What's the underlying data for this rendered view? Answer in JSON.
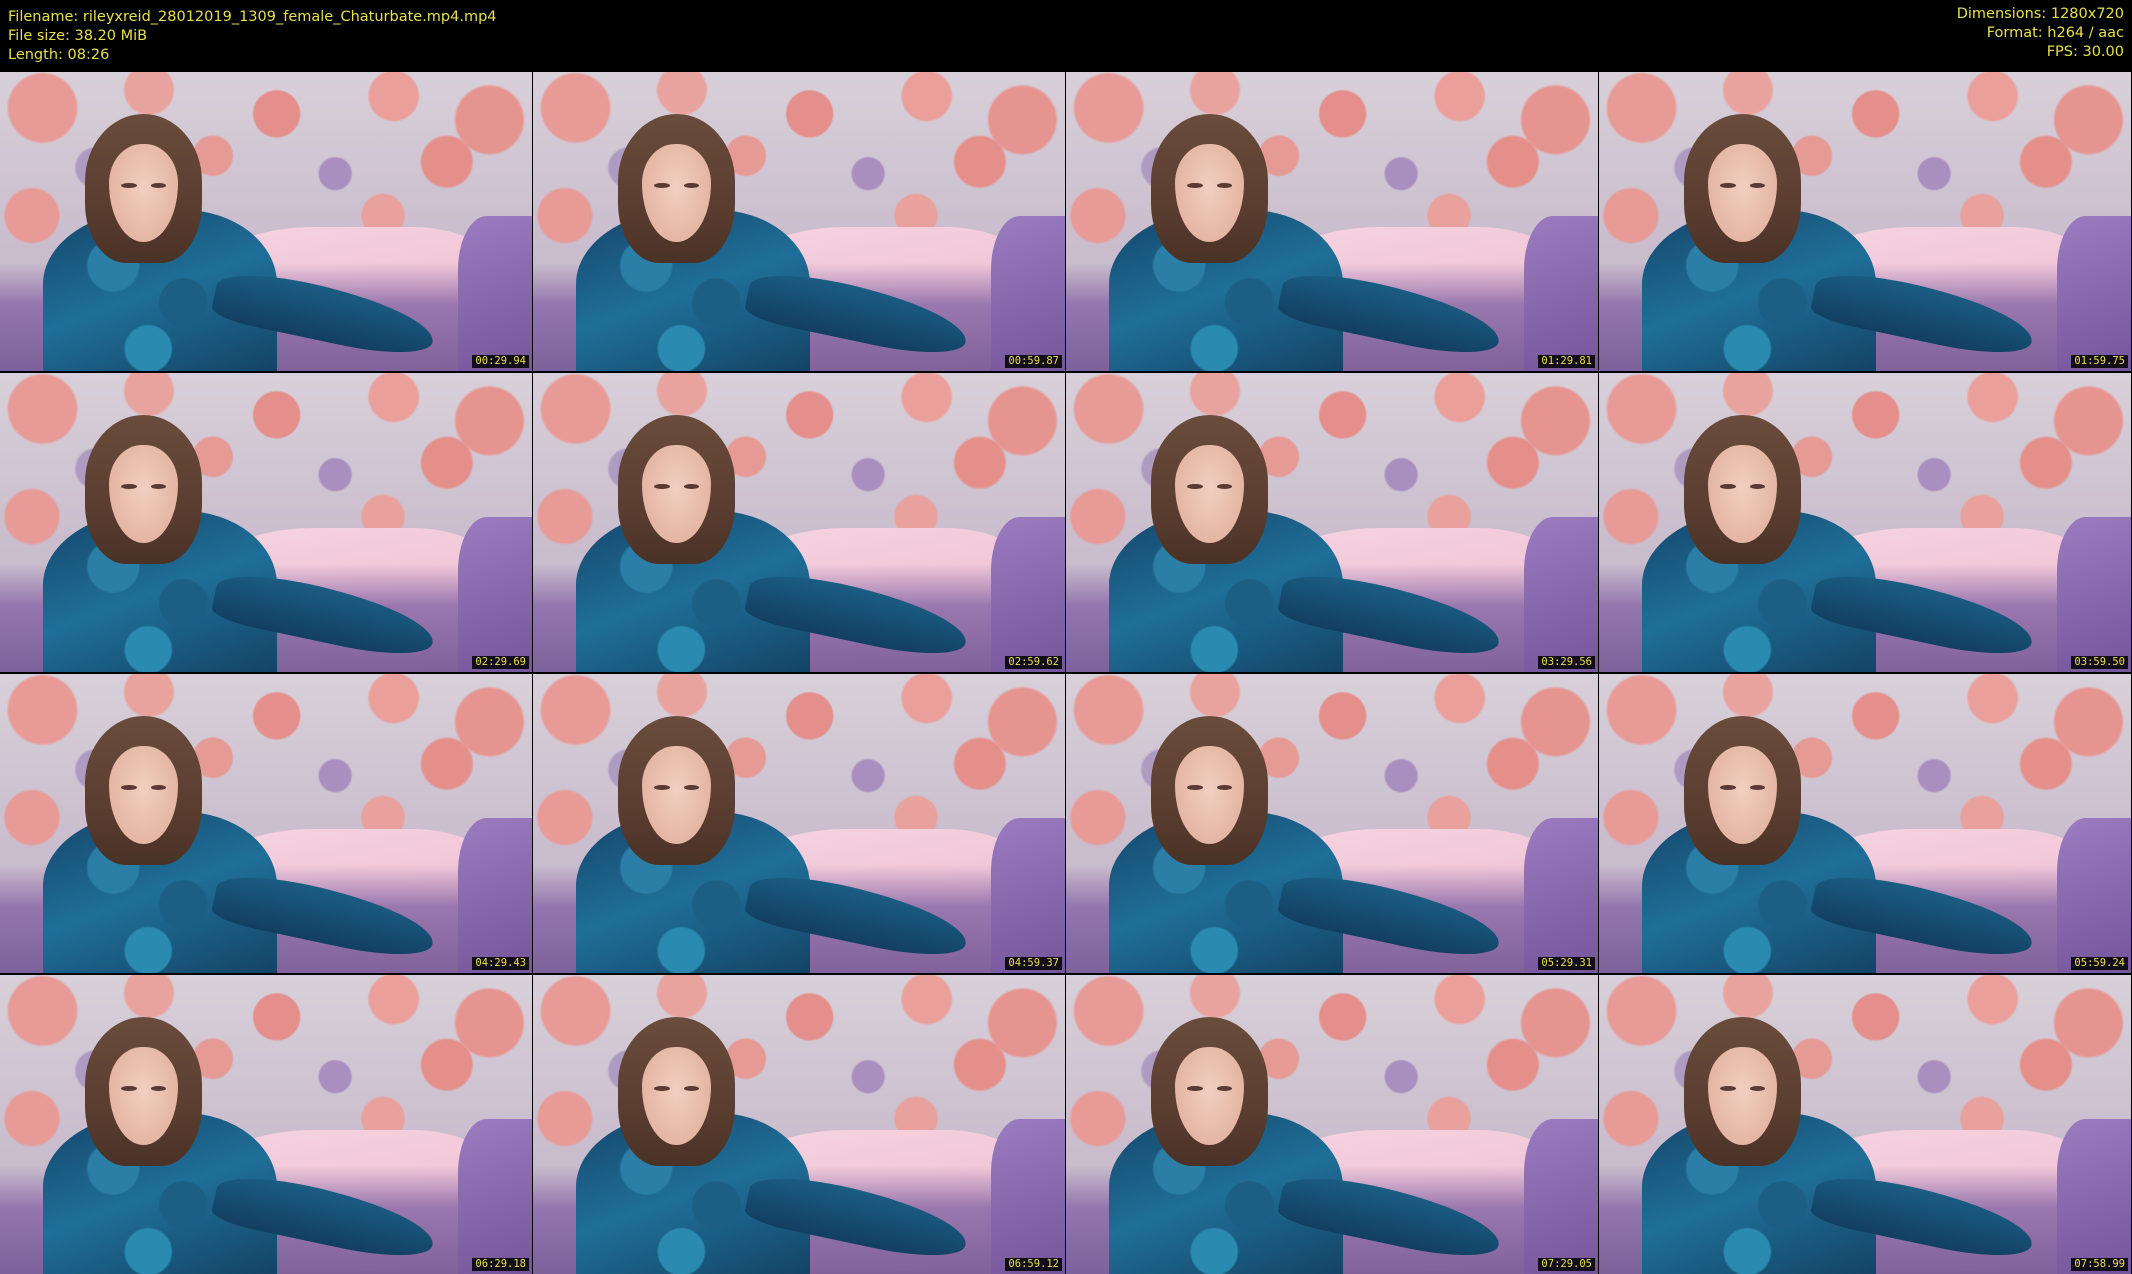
{
  "header": {
    "filename_label": "Filename: rileyxreid_28012019_1309_female_Chaturbate.mp4.mp4",
    "filesize_label": "File size: 38.20 MiB",
    "length_label": "Length: 08:26",
    "dimensions_label": "Dimensions: 1280x720",
    "format_label": "Format: h264 / aac",
    "fps_label": "FPS: 30.00"
  },
  "thumbnails": [
    {
      "timestamp": "00:29.94"
    },
    {
      "timestamp": "00:59.87"
    },
    {
      "timestamp": "01:29.81"
    },
    {
      "timestamp": "01:59.75"
    },
    {
      "timestamp": "02:29.69"
    },
    {
      "timestamp": "02:59.62"
    },
    {
      "timestamp": "03:29.56"
    },
    {
      "timestamp": "03:59.50"
    },
    {
      "timestamp": "04:29.43"
    },
    {
      "timestamp": "04:59.37"
    },
    {
      "timestamp": "05:29.31"
    },
    {
      "timestamp": "05:59.24"
    },
    {
      "timestamp": "06:29.18"
    },
    {
      "timestamp": "06:59.12"
    },
    {
      "timestamp": "07:29.05"
    },
    {
      "timestamp": "07:58.99"
    }
  ],
  "colors": {
    "header_text": "#e6e04a",
    "background": "#000000"
  }
}
